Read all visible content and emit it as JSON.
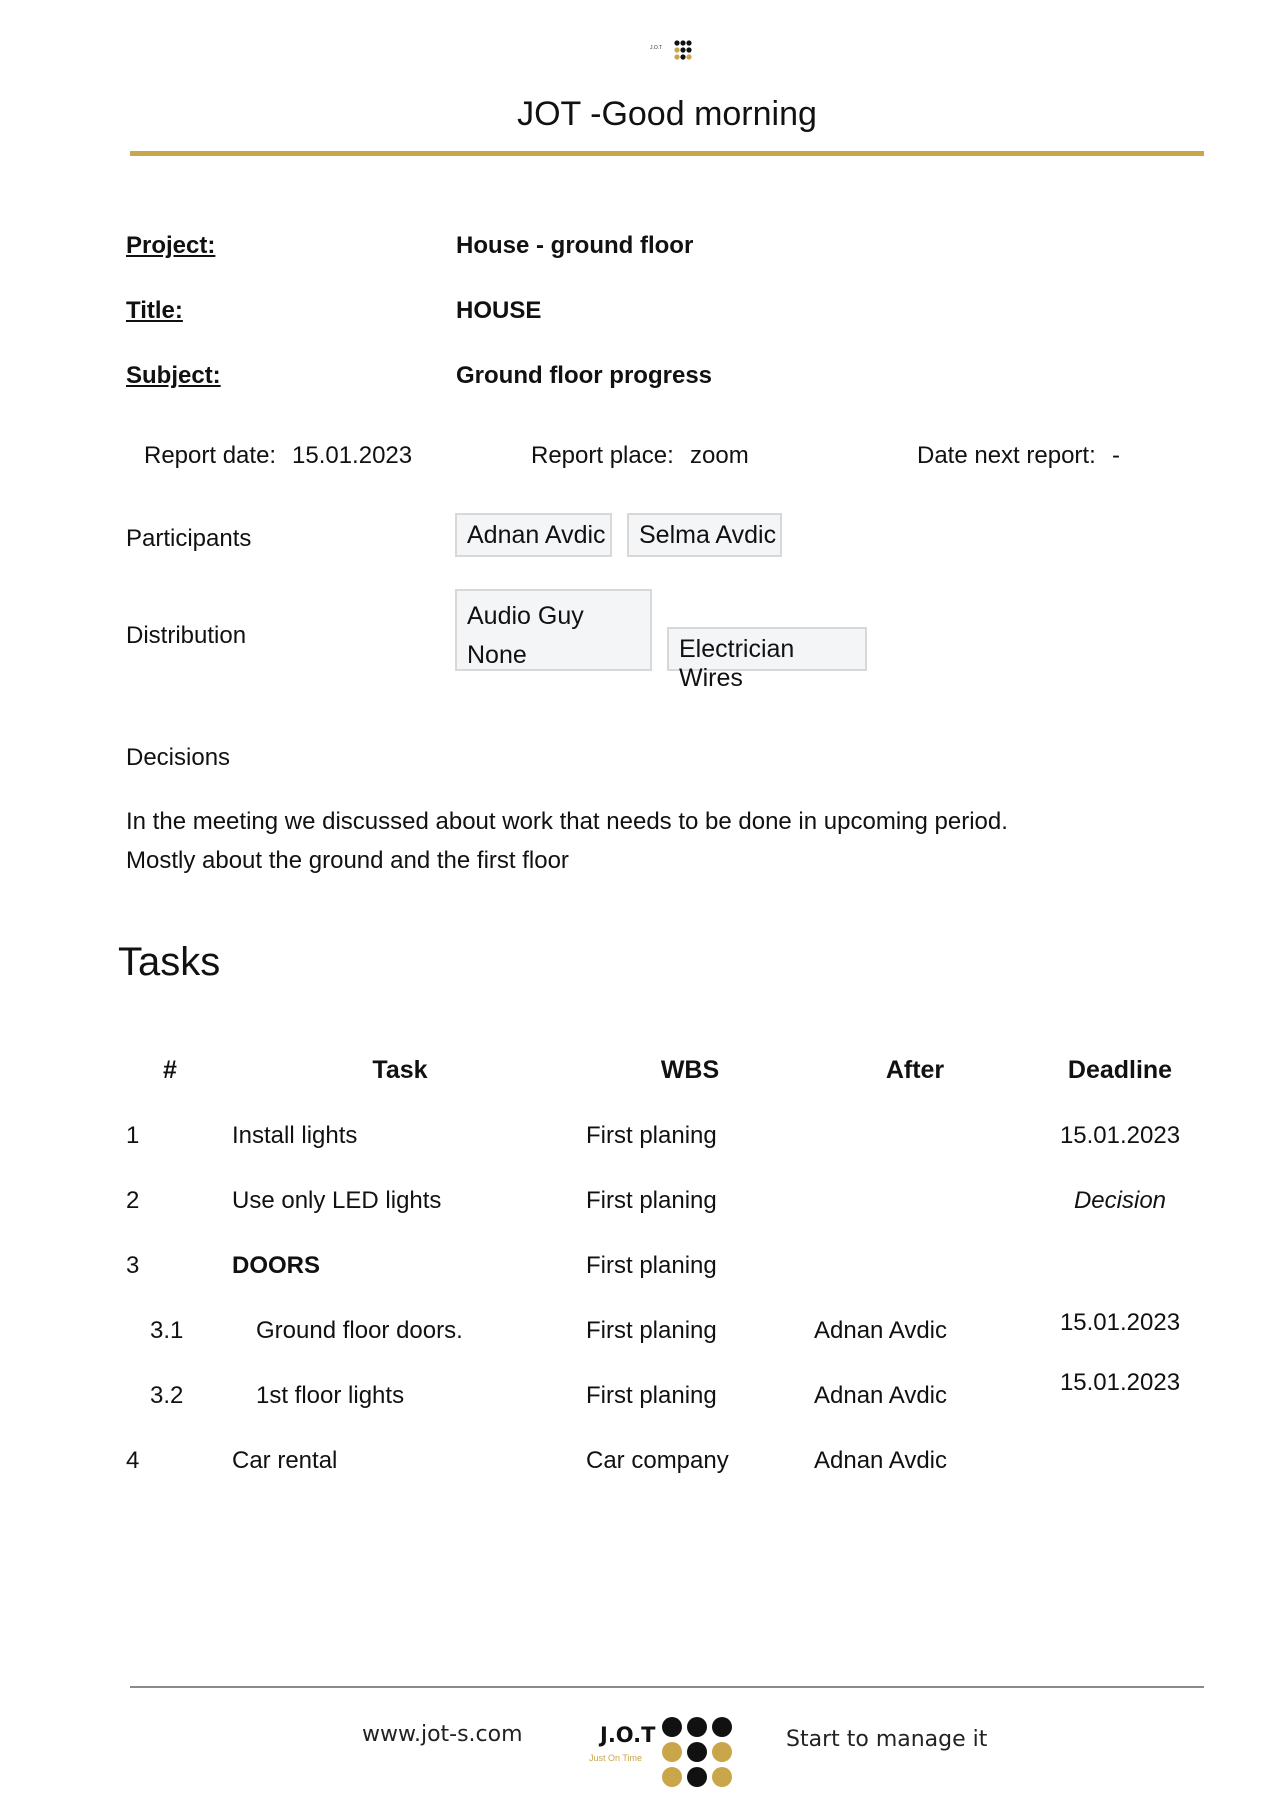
{
  "header": {
    "title": "JOT -Good morning",
    "logo_text": "J.O.T",
    "accent_color": "#c9a64a"
  },
  "meta": {
    "project_label": "Project:",
    "project_value": "House - ground floor",
    "title_label": "Title:",
    "title_value": "HOUSE",
    "subject_label": "Subject:",
    "subject_value": "Ground floor progress",
    "report_date_label": "Report date:",
    "report_date_value": "15.01.2023",
    "report_place_label": "Report place:",
    "report_place_value": "zoom",
    "next_report_label": "Date next report:",
    "next_report_value": "-"
  },
  "participants": {
    "label": "Participants",
    "people": [
      "Adnan Avdic",
      "Selma Avdic"
    ]
  },
  "distribution": {
    "label": "Distribution",
    "entries": [
      {
        "name": "Audio Guy",
        "sub": "None"
      },
      {
        "name": "Electrician Wires"
      }
    ]
  },
  "decisions": {
    "label": "Decisions",
    "lines": [
      "In the meeting we discussed about work that needs to be done in upcoming period.",
      "Mostly about the ground and the first floor"
    ]
  },
  "tasks": {
    "heading": "Tasks",
    "columns": [
      "#",
      "Task",
      "WBS",
      "After",
      "Deadline"
    ],
    "rows": [
      {
        "num": "1",
        "task": "Install lights",
        "wbs": "First planing",
        "after": "",
        "deadline": "15.01.2023"
      },
      {
        "num": "2",
        "task": "Use only LED lights",
        "wbs": "First planing",
        "after": "",
        "deadline": "Decision"
      },
      {
        "num": "3",
        "task": "DOORS",
        "wbs": "First planing",
        "after": "",
        "deadline": ""
      },
      {
        "num": "3.1",
        "task": "Ground floor doors.",
        "wbs": "First planing",
        "after": "Adnan Avdic",
        "deadline": "15.01.2023"
      },
      {
        "num": "3.2",
        "task": "1st floor lights",
        "wbs": "First planing",
        "after": "Adnan Avdic",
        "deadline": "15.01.2023"
      },
      {
        "num": "4",
        "task": "Car rental",
        "wbs": "Car company",
        "after": "Adnan Avdic",
        "deadline": ""
      }
    ]
  },
  "footer": {
    "website": "www.jot-s.com",
    "brand": "J.O.T",
    "brand_tagline": "Just On Time",
    "slogan": "Start to manage it"
  }
}
